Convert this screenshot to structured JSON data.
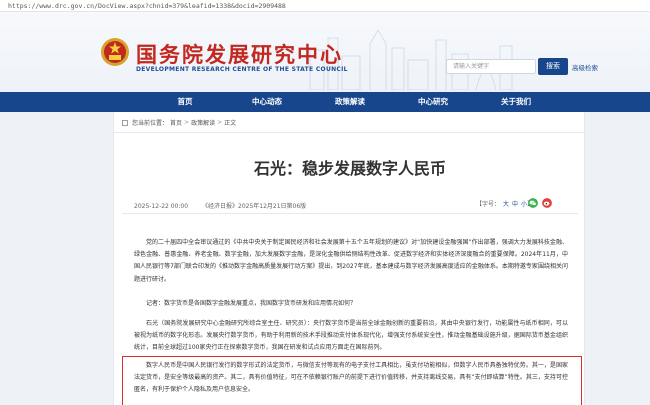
{
  "browser": {
    "url": "https://www.drc.gov.cn/DocView.aspx?chnid=379&leafid=1338&docid=2909488"
  },
  "header": {
    "logo_cn": "国务院发展研究中心",
    "logo_en": "DEVELOPMENT RESEARCH CENTRE OF THE STATE COUNCIL",
    "search_placeholder": "请输入关键字",
    "search_button": "搜索",
    "advanced_search": "高级检索"
  },
  "nav": {
    "items": [
      "首页",
      "中心动态",
      "政策解读",
      "中心研究",
      "关于我们"
    ]
  },
  "breadcrumb": {
    "items": [
      "您当前位置：",
      "首页",
      "政策解读",
      "正文"
    ]
  },
  "article": {
    "title": "石光：稳步发展数字人民币",
    "date": "2025-12-22 00:00",
    "source": "《经济日报》2025年12月21日第06版",
    "font_size_label": "【字号：",
    "font_sizes": [
      "大",
      "中",
      "小"
    ],
    "font_size_close": "】",
    "paragraphs": [
      "党的二十届四中全会审议通过的《中共中央关于制定国民经济和社会发展第十五个五年规划的建议》对“加快建设金融强国”作出部署，强调大力发展科技金融、绿色金融、普惠金融、养老金融、数字金融，加大发展数字金融，是深化金融供给侧结构性改革、促进数字经济和实体经济深度融合的重要保障。2024年11月，中国人民银行等7部门联合印发的《推动数字金融高质量发展行动方案》提出，到2027年底，基本建成与数字经济发展高度适应的金融体系。本期特邀专家围绕相关问题进行研讨。",
      "记者：数字货币是各国数字金融发展重点，我国数字货币研发和应用情况如何？",
      "石光（国务院发展研究中心金融研究所综合室主任、研究员）：央行数字货币是当前全球金融创新的重要前沿，其由中央银行发行，功能属性与纸币相同，可以被视为纸币的数字化形态。发展央行数字货币，有助于利用新的技术手段推动支付体系现代化，增强支付系统安全性，推动金融基础设施升级，据国际货币基金组织统计，目前全球超过100家央行正在探索数字货币，我国在研发和试点应用方面走在国际前列。",
      "数字人民币是中国人民银行发行的数字形式的法定货币，与微信支付等现有的电子支付工具相比，虽支付功能相似，但数字人民币具备独特优势。其一，是国家法定货币，是安全等级最高的资产。其二，具有价值特征，可在不依赖银行账户的前提下进行价值转移，并支持离线交易，具有“支付即结算”特性。其三，支持可控匿名，有利于保护个人隐私及用户信息安全。"
    ]
  },
  "colors": {
    "brand_red": "#c2281f",
    "brand_blue": "#17468c",
    "highlight_border": "#d8302a",
    "wechat": "#3bb34a",
    "weibo": "#e2413b"
  }
}
